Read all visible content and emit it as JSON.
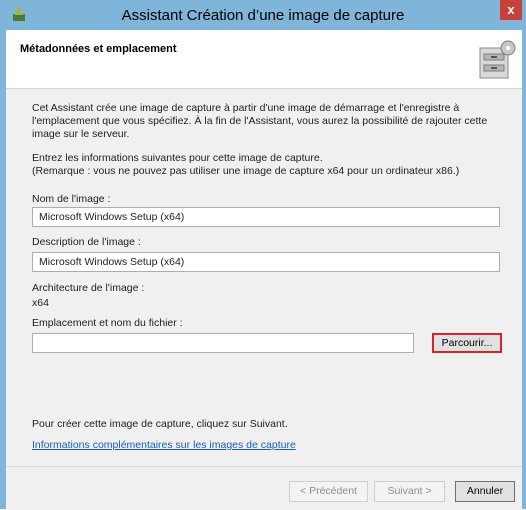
{
  "window": {
    "title": "Assistant Création d’une image de capture",
    "close": "x"
  },
  "header": {
    "heading": "Métadonnées et emplacement"
  },
  "intro": {
    "line1": "Cet Assistant crée une image de capture à partir d'une image de démarrage et l'enregistre à",
    "line2": "l'emplacement que vous spécifiez. À la fin de l'Assistant, vous aurez la possibilité de rajouter cette",
    "line3": "image sur le serveur."
  },
  "instructions": {
    "line1": "Entrez les informations suivantes pour cette image de capture.",
    "line2": "(Remarque : vous ne pouvez pas utiliser une image de capture x64 pour un ordinateur x86.)"
  },
  "form": {
    "name_label": "Nom de l'image :",
    "name_value": "Microsoft Windows Setup (x64)",
    "description_label": "Description de l'image :",
    "description_value": "Microsoft Windows Setup (x64)",
    "arch_label": "Architecture de l'image :",
    "arch_value": "x64",
    "path_label": "Emplacement et nom du fichier :",
    "path_value": "",
    "browse_label": "Parcourir..."
  },
  "bottom_text": "Pour créer cette image de capture, cliquez sur Suivant.",
  "more_info_link": "Informations complémentaires sur les images de capture",
  "footer": {
    "back": "< Précédent",
    "next": "Suivant >",
    "cancel": "Annuler"
  }
}
